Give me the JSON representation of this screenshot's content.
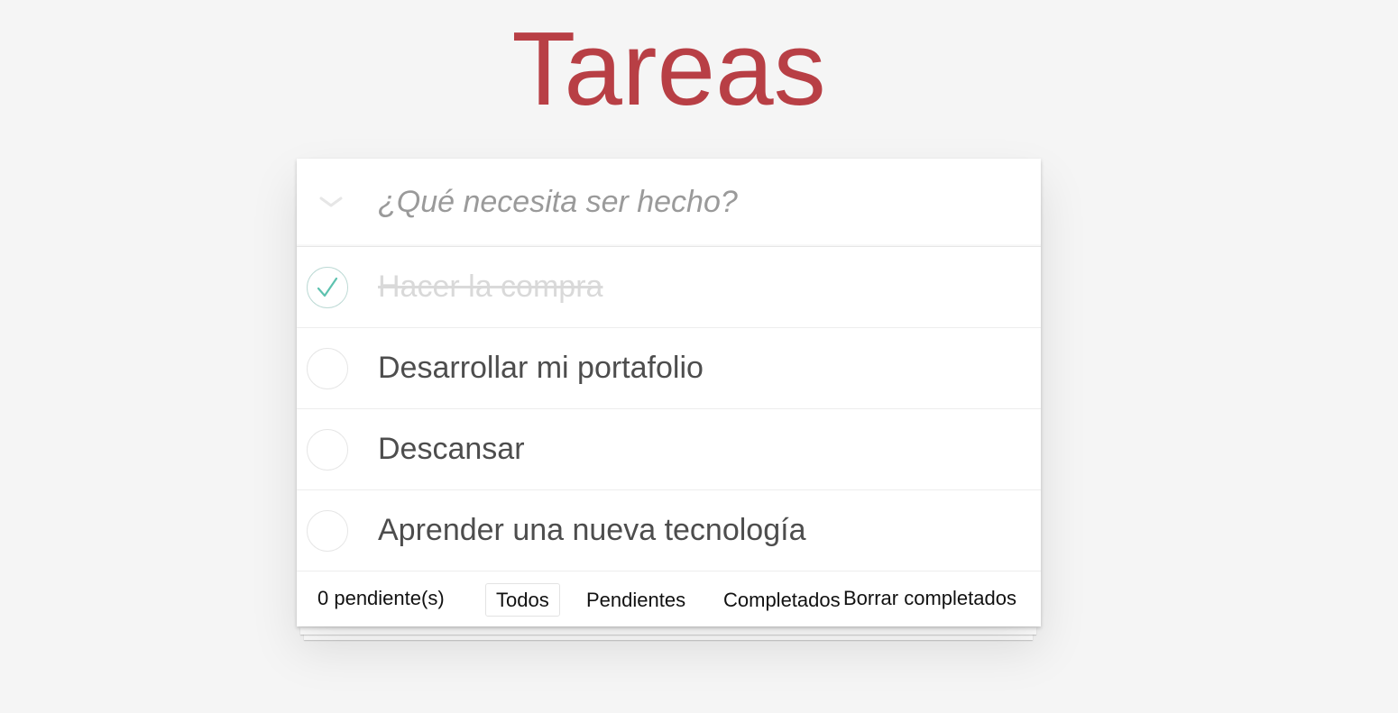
{
  "app": {
    "title": "Tareas"
  },
  "new_todo": {
    "placeholder": "¿Qué necesita ser hecho?",
    "value": ""
  },
  "todos": [
    {
      "label": "Hacer la compra",
      "completed": true
    },
    {
      "label": "Desarrollar mi portafolio",
      "completed": false
    },
    {
      "label": "Descansar",
      "completed": false
    },
    {
      "label": "Aprender una nueva tecnología",
      "completed": false
    }
  ],
  "footer": {
    "pending_count": "0 pendiente(s)",
    "filters": [
      {
        "label": "Todos",
        "selected": true
      },
      {
        "label": "Pendientes",
        "selected": false
      },
      {
        "label": "Completados",
        "selected": false
      }
    ],
    "clear_completed": "Borrar completados"
  },
  "colors": {
    "title": "#b83f45",
    "background": "#f5f5f5",
    "check_mark": "#5dc2af",
    "completed_text": "#d9d9d9"
  },
  "icons": {
    "toggle_all": "chevron-down-icon",
    "completed_check": "checkmark-icon"
  }
}
